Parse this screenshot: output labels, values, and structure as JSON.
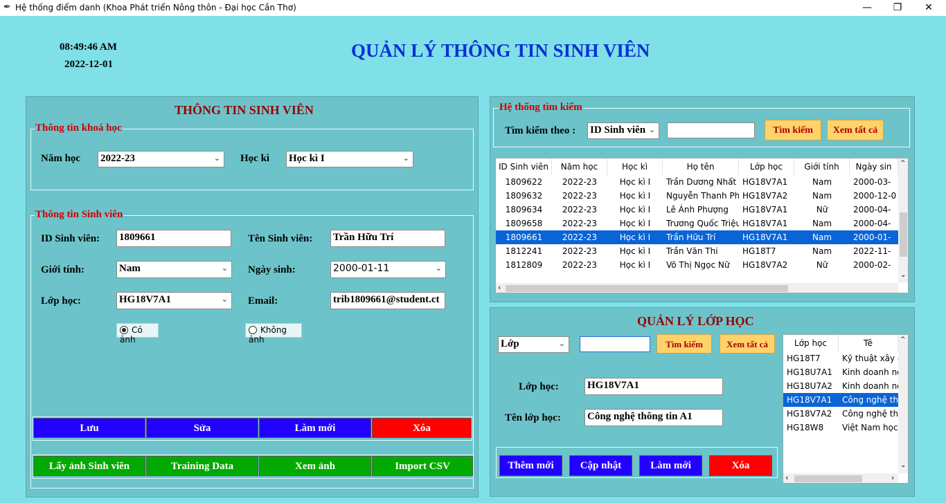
{
  "window": {
    "title": "Hệ thống điểm danh (Khoa Phát triển Nông thôn - Đại học Cần Thơ)"
  },
  "clock": {
    "time": "08:49:46 AM",
    "date": "2022-12-01"
  },
  "page_title": "QUẢN LÝ THÔNG TIN SINH VIÊN",
  "student_panel": {
    "title": "THÔNG TIN SINH VIÊN",
    "course_group": {
      "legend": "Thông tin khoá học",
      "year_label": "Năm học",
      "year_value": "2022-23",
      "semester_label": "Học kì",
      "semester_value": "Học kì I"
    },
    "info_group": {
      "legend": "Thông tin Sinh viên",
      "id_label": "ID Sinh viên:",
      "id_value": "1809661",
      "name_label": "Tên Sinh viên:",
      "name_value": "Trần Hữu Trí",
      "gender_label": "Giới tính:",
      "gender_value": "Nam",
      "dob_label": "Ngày sinh:",
      "dob_value": "2000-01-11",
      "class_label": "Lớp học:",
      "class_value": "HG18V7A1",
      "email_label": "Email:",
      "email_value": "trib1809661@student.ct",
      "radio_photo": "Có ảnh",
      "radio_nophoto": "Không ảnh"
    },
    "buttons_row1": [
      "Lưu",
      "Sửa",
      "Làm mới",
      "Xóa"
    ],
    "buttons_row2": [
      "Lấy ảnh Sinh viên",
      "Training Data",
      "Xem ảnh",
      "Import CSV"
    ]
  },
  "search_panel": {
    "legend": "Hệ thống tìm kiếm",
    "search_by_label": "Tìm kiếm theo :",
    "search_by_value": "ID Sinh viên",
    "search_text": "",
    "search_button": "Tìm kiếm",
    "view_all_button": "Xem tất cả",
    "table": {
      "columns": [
        "ID Sinh viên",
        "Năm học",
        "Học kì",
        "Họ tên",
        "Lớp học",
        "Giới tính",
        "Ngày sin"
      ],
      "rows": [
        [
          "1809622",
          "2022-23",
          "Học kì I",
          "Trần Dương Nhất",
          "HG18V7A1",
          "Nam",
          "2000-03-"
        ],
        [
          "1809632",
          "2022-23",
          "Học kì I",
          "Nguyễn Thanh Pho",
          "HG18V7A2",
          "Nam",
          "2000-12-0"
        ],
        [
          "1809634",
          "2022-23",
          "Học kì I",
          "Lê Ánh Phượng",
          "HG18V7A1",
          "Nữ",
          "2000-04-"
        ],
        [
          "1809658",
          "2022-23",
          "Học kì I",
          "Trương Quốc Triệu",
          "HG18V7A1",
          "Nam",
          "2000-04-"
        ],
        [
          "1809661",
          "2022-23",
          "Học kì I",
          "Trần Hữu Trí",
          "HG18V7A1",
          "Nam",
          "2000-01-"
        ],
        [
          "1812241",
          "2022-23",
          "Học kì I",
          "Trần Văn Thi",
          "HG18T7",
          "Nam",
          "2022-11-"
        ],
        [
          "1812809",
          "2022-23",
          "Học kì I",
          "Võ Thị Ngọc Nữ",
          "HG18V7A2",
          "Nữ",
          "2000-02-"
        ]
      ],
      "selected_row": 4
    }
  },
  "class_panel": {
    "title": "QUẢN LÝ LỚP HỌC",
    "filter_value": "Lớp",
    "filter_text": "",
    "search_button": "Tìm kiếm",
    "view_all_button": "Xem tất cả",
    "class_label": "Lớp học:",
    "class_value": "HG18V7A1",
    "class_name_label": "Tên lớp học:",
    "class_name_value": "Công nghệ thông tin A1",
    "buttons": [
      "Thêm mới",
      "Cập nhật",
      "Làm mới",
      "Xóa"
    ],
    "table": {
      "columns": [
        "Lớp học",
        "Tê"
      ],
      "rows": [
        [
          "HG18T7",
          "Kỹ thuật xây dự"
        ],
        [
          "HG18U7A1",
          "Kinh doanh nô"
        ],
        [
          "HG18U7A2",
          "Kinh doanh nô"
        ],
        [
          "HG18V7A1",
          "Công nghệ thô"
        ],
        [
          "HG18V7A2",
          "Công nghệ thô"
        ],
        [
          "HG18W8",
          "Việt Nam học"
        ]
      ],
      "selected_row": 3
    }
  },
  "colors": {
    "background": "#7fe0e8",
    "panel": "#6cc4ca",
    "title_blue": "#0a2fd6",
    "legend_red": "#cc0000",
    "selection": "#0a64d6"
  }
}
